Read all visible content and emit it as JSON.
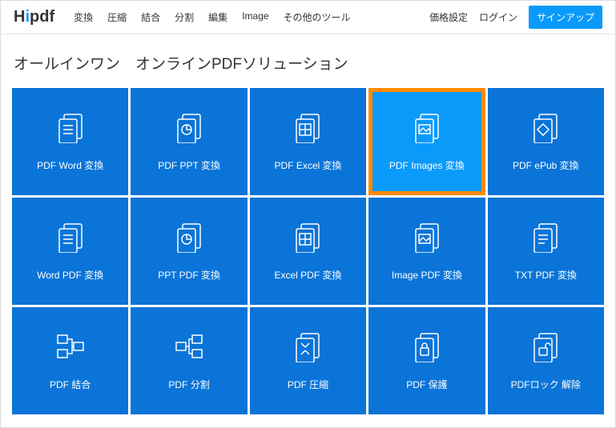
{
  "header": {
    "logo_pre": "H",
    "logo_color": "i",
    "logo_post": "pdf",
    "nav": [
      "変換",
      "圧縮",
      "結合",
      "分割",
      "編集",
      "Image",
      "その他のツール"
    ],
    "right": {
      "pricing": "価格設定",
      "login": "ログイン",
      "signup": "サインアップ"
    }
  },
  "title": "オールインワン　オンラインPDFソリューション",
  "tiles": [
    {
      "label": "PDF Word 変換",
      "highlight": false
    },
    {
      "label": "PDF PPT 変換",
      "highlight": false
    },
    {
      "label": "PDF Excel 変換",
      "highlight": false
    },
    {
      "label": "PDF Images 変換",
      "highlight": true
    },
    {
      "label": "PDF ePub 変換",
      "highlight": false
    },
    {
      "label": "Word PDF 変換",
      "highlight": false
    },
    {
      "label": "PPT PDF 変換",
      "highlight": false
    },
    {
      "label": "Excel PDF 変換",
      "highlight": false
    },
    {
      "label": "Image PDF 変換",
      "highlight": false
    },
    {
      "label": "TXT PDF 変換",
      "highlight": false
    },
    {
      "label": "PDF 結合",
      "highlight": false
    },
    {
      "label": "PDF 分割",
      "highlight": false
    },
    {
      "label": "PDF 圧縮",
      "highlight": false
    },
    {
      "label": "PDF 保護",
      "highlight": false
    },
    {
      "label": "PDFロック 解除",
      "highlight": false
    }
  ]
}
